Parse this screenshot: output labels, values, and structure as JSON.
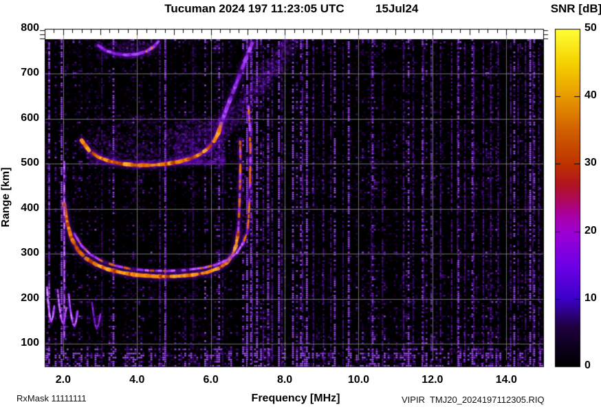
{
  "title": {
    "main": "Tucuman 2024 197 11:23:05 UTC",
    "date": "15Jul24"
  },
  "footer": {
    "rxmask": "RxMask 11111111",
    "file": "VIPIR  TMJ20_2024197112305.RIQ"
  },
  "chart_data": {
    "type": "heatmap",
    "title": "Tucuman 2024 197 11:23:05 UTC",
    "date_label": "15Jul24",
    "xlabel": "Frequency [MHz]",
    "ylabel": "Range [km]",
    "colorbar_label": "SNR [dB]",
    "xlim": [
      1.5,
      15.0
    ],
    "ylim": [
      50,
      800
    ],
    "data_top_range": 777,
    "grid": true,
    "x_major_ticks": [
      2,
      4,
      6,
      8,
      10,
      12,
      14
    ],
    "x_tick_labels": [
      "2.0",
      "4.0",
      "6.0",
      "8.0",
      "10.0",
      "12.0",
      "14.0"
    ],
    "x_minor_step": 0.25,
    "y_major_ticks": [
      100,
      200,
      300,
      400,
      500,
      600,
      700,
      800
    ],
    "y_tick_labels": [
      "100",
      "200",
      "300",
      "400",
      "500",
      "600",
      "700",
      "800"
    ],
    "colorbar": {
      "min": 0,
      "max": 50,
      "ticks": [
        0,
        10,
        20,
        30,
        40,
        50
      ],
      "tick_labels": [
        "0",
        "10",
        "20",
        "30",
        "40",
        "50"
      ],
      "stops": [
        [
          0.0,
          "#000000"
        ],
        [
          0.06,
          "#0d001f"
        ],
        [
          0.12,
          "#200043"
        ],
        [
          0.2,
          "#3c00c8"
        ],
        [
          0.3,
          "#6f00e6"
        ],
        [
          0.4,
          "#9e00d2"
        ],
        [
          0.45,
          "#a900a0"
        ],
        [
          0.5,
          "#ae0a50"
        ],
        [
          0.54,
          "#b01620"
        ],
        [
          0.6,
          "#bf3300"
        ],
        [
          0.7,
          "#d06000"
        ],
        [
          0.8,
          "#e89b00"
        ],
        [
          0.9,
          "#f6d200"
        ],
        [
          1.0,
          "#ffff38"
        ]
      ]
    },
    "palettes": {
      "hot": [
        "#b83800",
        "#d85a00",
        "#f07800",
        "#ff9210",
        "#ffb028"
      ],
      "mixed": [
        "#e06800",
        "#a030e8",
        "#c050ff",
        "#f08000"
      ],
      "mixedViolet": [
        "#b040ff",
        "#d06aff",
        "#e86c00",
        "#9b30f0"
      ],
      "violet": [
        "#7a18d8",
        "#9b30f0",
        "#b050ff"
      ],
      "brightViolet": [
        "#c060ff",
        "#d88aff",
        "#a840ff"
      ],
      "glow": "#5c00b8",
      "glow2": "#8a1be0"
    },
    "traces": [
      {
        "name": "F-layer 1st hop O-mode",
        "palette": "hot",
        "core": 5,
        "glow": 15,
        "gap": 0.07,
        "points": [
          [
            2.02,
            412
          ],
          [
            2.1,
            372
          ],
          [
            2.22,
            336
          ],
          [
            2.4,
            308
          ],
          [
            2.62,
            290
          ],
          [
            2.9,
            276
          ],
          [
            3.2,
            266
          ],
          [
            3.6,
            258
          ],
          [
            4.0,
            253
          ],
          [
            4.5,
            250
          ],
          [
            5.0,
            250
          ],
          [
            5.5,
            253
          ],
          [
            5.9,
            259
          ],
          [
            6.2,
            268
          ],
          [
            6.42,
            280
          ],
          [
            6.58,
            296
          ],
          [
            6.68,
            318
          ],
          [
            6.74,
            348
          ]
        ]
      },
      {
        "name": "F-layer 1st hop O-mode asymptote",
        "palette": "mixed",
        "core": 3.2,
        "glow": 9,
        "gap": 0.3,
        "points": [
          [
            6.74,
            348
          ],
          [
            6.77,
            400
          ],
          [
            6.79,
            455
          ],
          [
            6.8,
            510
          ],
          [
            6.79,
            555
          ]
        ]
      },
      {
        "name": "F-layer 1st hop X-mode",
        "palette": "mixedViolet",
        "core": 3,
        "glow": 8,
        "gap": 0.22,
        "points": [
          [
            2.3,
            345
          ],
          [
            2.5,
            318
          ],
          [
            2.75,
            298
          ],
          [
            3.05,
            284
          ],
          [
            3.4,
            274
          ],
          [
            3.8,
            267
          ],
          [
            4.3,
            263
          ],
          [
            4.8,
            262
          ],
          [
            5.3,
            264
          ],
          [
            5.8,
            269
          ],
          [
            6.15,
            276
          ],
          [
            6.45,
            287
          ],
          [
            6.7,
            302
          ],
          [
            6.88,
            325
          ],
          [
            7.0,
            352
          ]
        ]
      },
      {
        "name": "F-layer 1st hop X-mode asymptote",
        "palette": "mixed",
        "core": 3,
        "glow": 8,
        "gap": 0.3,
        "points": [
          [
            7.0,
            352
          ],
          [
            7.04,
            410
          ],
          [
            7.06,
            470
          ],
          [
            7.07,
            530
          ],
          [
            7.05,
            585
          ],
          [
            7.02,
            628
          ]
        ]
      },
      {
        "name": "F-layer 2nd hop",
        "palette": "hot",
        "core": 5,
        "glow": 16,
        "gap": 0.12,
        "points": [
          [
            2.5,
            552
          ],
          [
            2.7,
            530
          ],
          [
            2.95,
            515
          ],
          [
            3.25,
            506
          ],
          [
            3.6,
            500
          ],
          [
            4.0,
            497
          ],
          [
            4.4,
            497
          ],
          [
            4.8,
            500
          ],
          [
            5.15,
            505
          ],
          [
            5.45,
            512
          ],
          [
            5.7,
            521
          ],
          [
            5.92,
            534
          ],
          [
            6.08,
            550
          ],
          [
            6.2,
            568
          ],
          [
            6.28,
            590
          ]
        ]
      },
      {
        "name": "F-layer 2nd hop rising tail",
        "palette": "violet",
        "core": 5,
        "glow": 14,
        "gap": 0.3,
        "points": [
          [
            6.28,
            590
          ],
          [
            6.45,
            628
          ],
          [
            6.62,
            664
          ],
          [
            6.8,
            702
          ],
          [
            6.98,
            740
          ],
          [
            7.12,
            768
          ]
        ]
      },
      {
        "name": "F-layer 3rd hop",
        "palette": "violet",
        "core": 4,
        "glow": 11,
        "gap": 0.15,
        "speck": 0.1,
        "points": [
          [
            2.95,
            763
          ],
          [
            3.15,
            752
          ],
          [
            3.4,
            745
          ],
          [
            3.7,
            742
          ],
          [
            4.0,
            744
          ],
          [
            4.25,
            750
          ],
          [
            4.45,
            760
          ],
          [
            4.58,
            772
          ]
        ]
      },
      {
        "name": "low-range cusp 1",
        "palette": "brightViolet",
        "core": 2.6,
        "glow": 6,
        "gap": 0.05,
        "points": [
          [
            1.56,
            226
          ],
          [
            1.59,
            196
          ],
          [
            1.62,
            172
          ],
          [
            1.65,
            156
          ],
          [
            1.68,
            150
          ],
          [
            1.72,
            160
          ],
          [
            1.76,
            184
          ]
        ]
      },
      {
        "name": "low-range cusp 2",
        "palette": "brightViolet",
        "core": 2.6,
        "glow": 6,
        "gap": 0.05,
        "points": [
          [
            1.85,
            220
          ],
          [
            1.89,
            188
          ],
          [
            1.93,
            164
          ],
          [
            1.97,
            150
          ],
          [
            2.0,
            146
          ],
          [
            2.04,
            156
          ],
          [
            2.08,
            180
          ]
        ]
      },
      {
        "name": "low-range cusp 3",
        "palette": "brightViolet",
        "core": 2.6,
        "glow": 6,
        "gap": 0.05,
        "points": [
          [
            2.15,
            210
          ],
          [
            2.19,
            180
          ],
          [
            2.23,
            158
          ],
          [
            2.27,
            144
          ],
          [
            2.31,
            140
          ],
          [
            2.35,
            150
          ],
          [
            2.39,
            172
          ]
        ]
      },
      {
        "name": "low-range cusp 4",
        "palette": "violet",
        "core": 2,
        "glow": 5,
        "gap": 0.3,
        "points": [
          [
            2.78,
            192
          ],
          [
            2.83,
            162
          ],
          [
            2.87,
            142
          ],
          [
            2.91,
            134
          ],
          [
            2.96,
            144
          ],
          [
            3.01,
            166
          ]
        ]
      },
      {
        "name": "interference line 2 MHz",
        "palette": "brightViolet",
        "core": 2,
        "glow": 5,
        "gap": 0.35,
        "points": [
          [
            2.03,
            505
          ],
          [
            2.03,
            380
          ],
          [
            2.035,
            250
          ],
          [
            2.03,
            115
          ]
        ]
      }
    ],
    "clouds": [
      {
        "name": "2nd hop spread",
        "f0": 2.65,
        "f1": 6.3,
        "r0": 500,
        "r1": 612,
        "count": 1500,
        "alpha": 0.3,
        "bias": 1.9
      },
      {
        "name": "2nd hop dense spread",
        "f0": 5.0,
        "f1": 6.35,
        "r0": 505,
        "r1": 600,
        "count": 700,
        "alpha": 0.38,
        "bias": 1.4
      },
      {
        "name": "2nd hop tail spread",
        "f0": 6.0,
        "f1": 8.2,
        "r_base": 560,
        "r_rise": 215,
        "spread_f": 0.22,
        "spread_r": 48,
        "count": 1100,
        "alpha": 0.3
      },
      {
        "name": "1st hop asymptote spread",
        "f0": 6.55,
        "f1": 7.15,
        "r0": 300,
        "r1": 560,
        "count": 300,
        "alpha": 0.2,
        "bias": 1.0
      },
      {
        "name": "3rd hop halo",
        "f0": 2.9,
        "f1": 4.6,
        "r0": 736,
        "r1": 772,
        "count": 320,
        "alpha": 0.28,
        "bias": 1.0
      }
    ],
    "noise": {
      "background": "#000000",
      "speckle_colors": [
        "#1c0038",
        "#30005e",
        "#4b0096",
        "#6a14c8",
        "#8c28f0",
        "#a855ff"
      ],
      "bright_colors": [
        "#4b0096",
        "#6a14c8",
        "#8c28f0",
        "#a855ff",
        "#c980ff"
      ],
      "bottom_band": {
        "r_max": 95,
        "boost": 2.3
      },
      "top_band": {
        "r_min": 757,
        "boost": 1.5
      },
      "strong_columns": [
        {
          "f": 1.62,
          "i": 0.85
        },
        {
          "f": 3.05,
          "i": 0.4
        },
        {
          "f": 4.62,
          "i": 0.55
        },
        {
          "f": 4.78,
          "i": 0.45
        },
        {
          "f": 5.52,
          "i": 0.4
        },
        {
          "f": 6.32,
          "i": 0.45
        },
        {
          "f": 7.12,
          "i": 0.6
        },
        {
          "f": 7.42,
          "i": 0.55
        },
        {
          "f": 7.55,
          "i": 0.8
        },
        {
          "f": 7.66,
          "i": 0.65
        },
        {
          "f": 7.92,
          "i": 0.55
        },
        {
          "f": 8.48,
          "i": 0.6
        },
        {
          "f": 8.78,
          "i": 0.5
        },
        {
          "f": 9.05,
          "i": 0.55
        },
        {
          "f": 9.25,
          "i": 0.5
        },
        {
          "f": 9.58,
          "i": 0.45
        },
        {
          "f": 10.35,
          "i": 0.4
        },
        {
          "f": 10.65,
          "i": 0.5
        },
        {
          "f": 11.22,
          "i": 0.55
        },
        {
          "f": 11.48,
          "i": 0.5
        },
        {
          "f": 11.75,
          "i": 0.55
        },
        {
          "f": 11.97,
          "i": 0.75
        },
        {
          "f": 12.22,
          "i": 0.55
        },
        {
          "f": 12.52,
          "i": 0.6
        },
        {
          "f": 12.68,
          "i": 0.55
        },
        {
          "f": 12.88,
          "i": 0.5
        },
        {
          "f": 13.12,
          "i": 0.55
        },
        {
          "f": 13.38,
          "i": 0.5
        },
        {
          "f": 13.58,
          "i": 0.55
        },
        {
          "f": 13.78,
          "i": 0.5
        },
        {
          "f": 14.12,
          "i": 0.55
        },
        {
          "f": 14.32,
          "i": 0.5
        },
        {
          "f": 14.52,
          "i": 0.55
        },
        {
          "f": 14.72,
          "i": 0.45
        },
        {
          "f": 14.88,
          "i": 0.5
        }
      ]
    }
  }
}
